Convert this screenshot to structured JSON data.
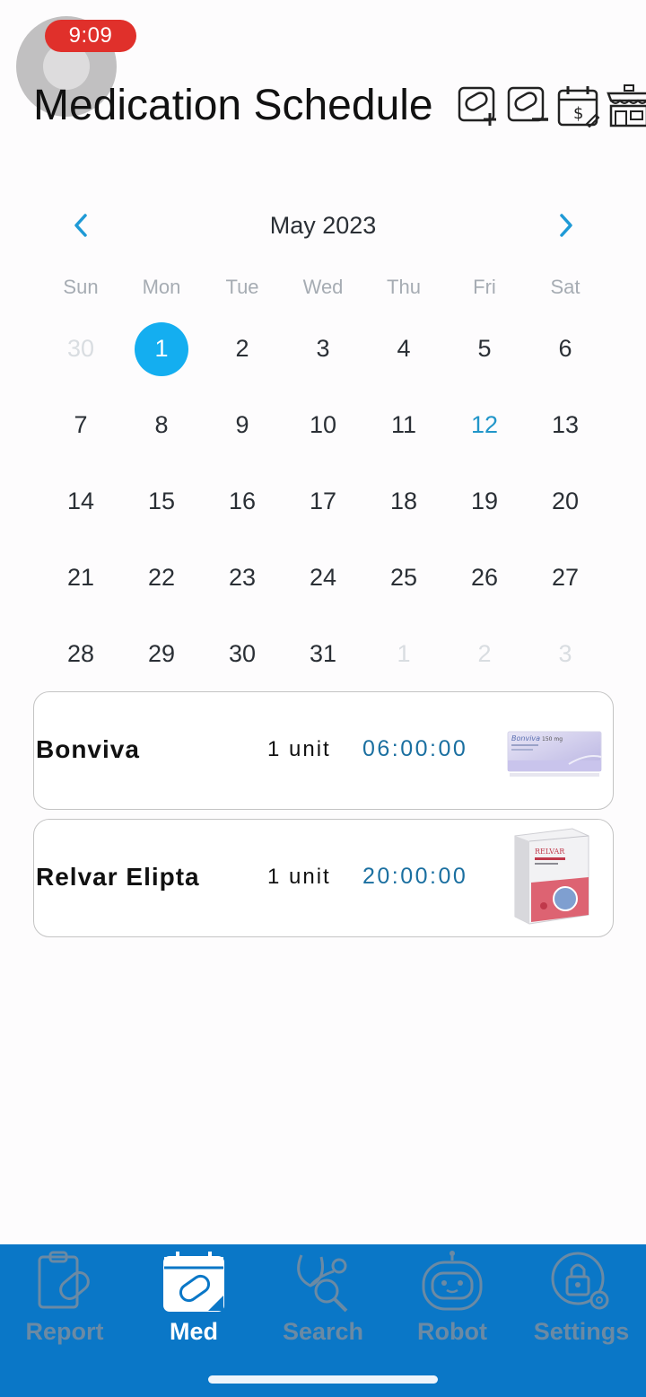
{
  "status": {
    "time": "9:09"
  },
  "header": {
    "title": "Medication Schedule",
    "icons": [
      "add-medication-icon",
      "remove-medication-icon",
      "billing-calendar-icon",
      "pharmacy-store-icon"
    ]
  },
  "calendar": {
    "month_label": "May 2023",
    "weekdays": [
      "Sun",
      "Mon",
      "Tue",
      "Wed",
      "Thu",
      "Fri",
      "Sat"
    ],
    "days": [
      {
        "n": "30",
        "s": "dim"
      },
      {
        "n": "1",
        "s": "selected"
      },
      {
        "n": "2"
      },
      {
        "n": "3"
      },
      {
        "n": "4"
      },
      {
        "n": "5"
      },
      {
        "n": "6"
      },
      {
        "n": "7"
      },
      {
        "n": "8"
      },
      {
        "n": "9"
      },
      {
        "n": "10"
      },
      {
        "n": "11"
      },
      {
        "n": "12",
        "s": "today"
      },
      {
        "n": "13"
      },
      {
        "n": "14"
      },
      {
        "n": "15"
      },
      {
        "n": "16"
      },
      {
        "n": "17"
      },
      {
        "n": "18"
      },
      {
        "n": "19"
      },
      {
        "n": "20"
      },
      {
        "n": "21"
      },
      {
        "n": "22"
      },
      {
        "n": "23"
      },
      {
        "n": "24"
      },
      {
        "n": "25"
      },
      {
        "n": "26"
      },
      {
        "n": "27"
      },
      {
        "n": "28"
      },
      {
        "n": "29"
      },
      {
        "n": "30"
      },
      {
        "n": "31"
      },
      {
        "n": "1",
        "s": "dim"
      },
      {
        "n": "2",
        "s": "dim"
      },
      {
        "n": "3",
        "s": "dim"
      }
    ],
    "selected_color": "#14aef0",
    "today_color": "#2196c9"
  },
  "medications": [
    {
      "name": "Bonviva",
      "quantity": "1 unit",
      "time": "06:00:00",
      "image": "bonviva-box"
    },
    {
      "name": "Relvar Elipta",
      "quantity": "1 unit",
      "time": "20:00:00",
      "image": "relvar-box"
    }
  ],
  "tabs": [
    {
      "label": "Report",
      "icon": "clipboard-pill-icon",
      "active": false
    },
    {
      "label": "Med",
      "icon": "calendar-pill-icon",
      "active": true
    },
    {
      "label": "Search",
      "icon": "stethoscope-search-icon",
      "active": false
    },
    {
      "label": "Robot",
      "icon": "robot-icon",
      "active": false
    },
    {
      "label": "Settings",
      "icon": "lock-gear-icon",
      "active": false
    }
  ],
  "colors": {
    "tabbar": "#0a77c7",
    "accent": "#14aef0"
  }
}
